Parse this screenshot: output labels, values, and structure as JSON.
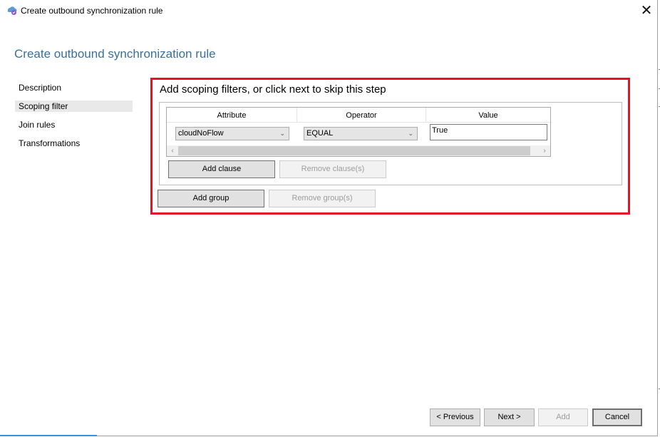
{
  "window": {
    "title": "Create outbound synchronization rule",
    "close_glyph": "✕"
  },
  "page": {
    "heading": "Create outbound synchronization rule"
  },
  "nav": {
    "items": [
      {
        "label": "Description",
        "selected": false
      },
      {
        "label": "Scoping filter",
        "selected": true
      },
      {
        "label": "Join rules",
        "selected": false
      },
      {
        "label": "Transformations",
        "selected": false
      }
    ]
  },
  "step": {
    "heading": "Add scoping filters, or click next to skip this step"
  },
  "grid": {
    "columns": [
      "Attribute",
      "Operator",
      "Value"
    ],
    "rows": [
      {
        "attribute": "cloudNoFlow",
        "operator": "EQUAL",
        "value": "True"
      }
    ]
  },
  "buttons": {
    "add_clause": "Add clause",
    "remove_clause": "Remove clause(s)",
    "add_group": "Add group",
    "remove_group": "Remove group(s)"
  },
  "footer": {
    "previous": "< Previous",
    "next": "Next >",
    "add": "Add",
    "cancel": "Cancel"
  },
  "icons": {
    "app": "sync-service-icon",
    "close": "close-icon",
    "dropdown": "chevron-down-icon",
    "scroll_left": "scroll-left-icon",
    "scroll_right": "scroll-right-icon"
  },
  "colors": {
    "heading_blue": "#3a6f9c",
    "highlight_red": "#e81123",
    "accent_blue": "#3c8fd6"
  }
}
